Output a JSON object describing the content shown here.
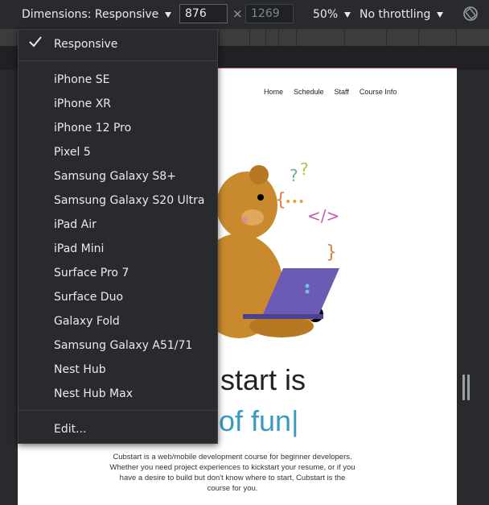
{
  "toolbar": {
    "dimensions_label": "Dimensions: Responsive",
    "width_value": "876",
    "height_placeholder": "1269",
    "times_symbol": "×",
    "zoom_label": "50%",
    "throttle_label": "No throttling",
    "rotate_icon": "rotate-icon"
  },
  "menu": {
    "selected": "Responsive",
    "check_icon": "checkmark-icon",
    "devices": [
      "iPhone SE",
      "iPhone XR",
      "iPhone 12 Pro",
      "Pixel 5",
      "Samsung Galaxy S8+",
      "Samsung Galaxy S20 Ultra",
      "iPad Air",
      "iPad Mini",
      "Surface Pro 7",
      "Surface Duo",
      "Galaxy Fold",
      "Samsung Galaxy A51/71",
      "Nest Hub",
      "Nest Hub Max"
    ],
    "edit_label": "Edit..."
  },
  "page": {
    "nav": [
      "Home",
      "Schedule",
      "Staff",
      "Course Info"
    ],
    "hero_line1": "start is",
    "hero_line2": "of fun",
    "hero_cursor": "|",
    "description": "Cubstart is a web/mobile development course for beginner developers. Whether you need project experiences to kickstart your resume, or if you have a desire to build but don't know where to start, Cubstart is the course for you.",
    "accent_color": "#3a9bc1",
    "topline_color": "#c2417a"
  }
}
